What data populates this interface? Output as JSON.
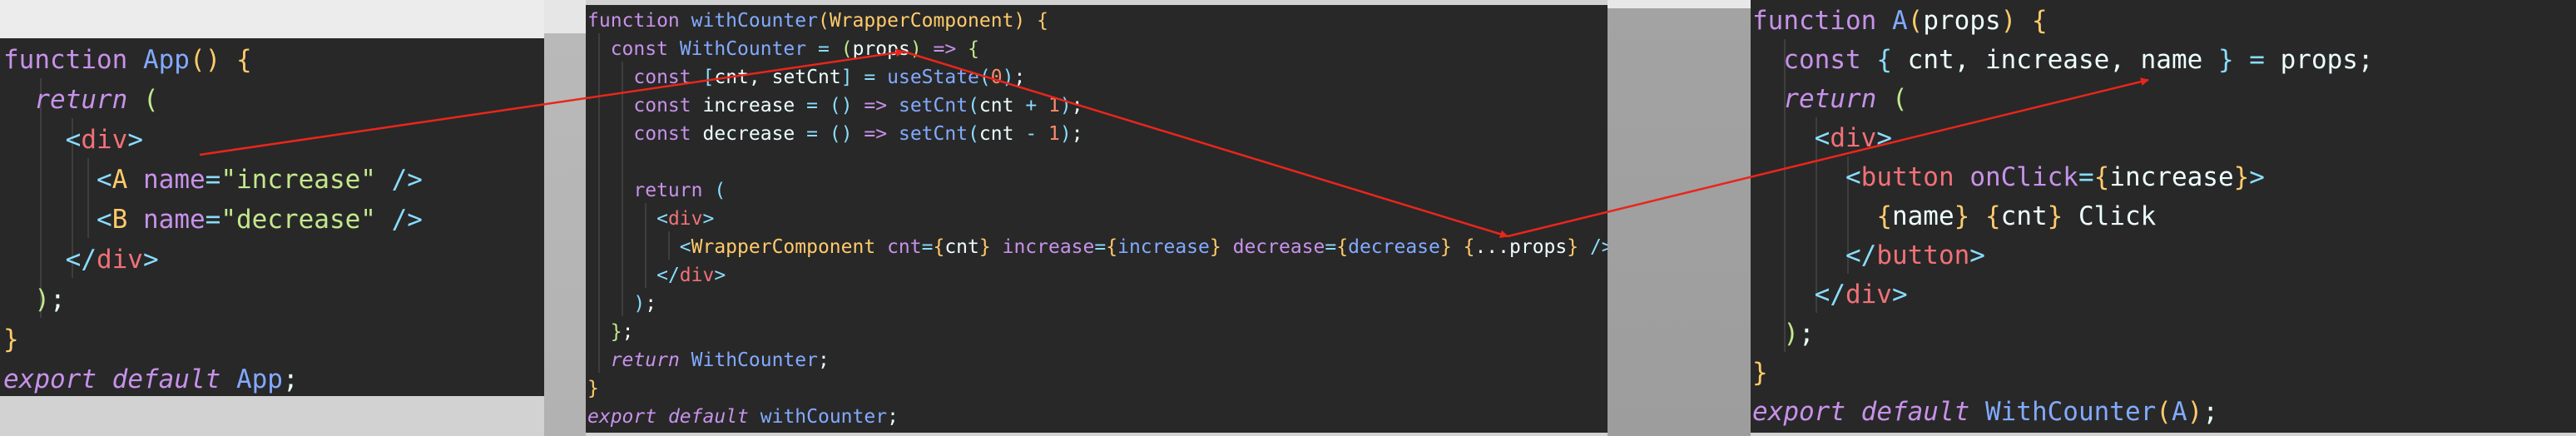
{
  "colors": {
    "editor_bg": "#282828",
    "arrow": "#e8261c"
  },
  "panel_app": {
    "lines": [
      [
        [
          "kw",
          "function"
        ],
        [
          "tx",
          " "
        ],
        [
          "fn",
          "App"
        ],
        [
          "br",
          "()"
        ],
        [
          "tx",
          " "
        ],
        [
          "br",
          "{"
        ]
      ],
      [
        [
          "tx",
          "  "
        ],
        [
          "kwi",
          "return"
        ],
        [
          "tx",
          " "
        ],
        [
          "pn",
          "("
        ]
      ],
      [
        [
          "tx",
          "    "
        ],
        [
          "op",
          "<"
        ],
        [
          "tg",
          "div"
        ],
        [
          "op",
          ">"
        ]
      ],
      [
        [
          "tx",
          "      "
        ],
        [
          "op",
          "<"
        ],
        [
          "br",
          "A"
        ],
        [
          "tx",
          " "
        ],
        [
          "at",
          "name"
        ],
        [
          "op",
          "="
        ],
        [
          "st",
          "\"increase\""
        ],
        [
          "tx",
          " "
        ],
        [
          "op",
          "/>"
        ]
      ],
      [
        [
          "tx",
          "      "
        ],
        [
          "op",
          "<"
        ],
        [
          "br",
          "B"
        ],
        [
          "tx",
          " "
        ],
        [
          "at",
          "name"
        ],
        [
          "op",
          "="
        ],
        [
          "st",
          "\"decrease\""
        ],
        [
          "tx",
          " "
        ],
        [
          "op",
          "/>"
        ]
      ],
      [
        [
          "tx",
          "    "
        ],
        [
          "op",
          "</"
        ],
        [
          "tg",
          "div"
        ],
        [
          "op",
          ">"
        ]
      ],
      [
        [
          "tx",
          "  "
        ],
        [
          "pn",
          ")"
        ],
        [
          "tx",
          ";"
        ]
      ],
      [
        [
          "br",
          "}"
        ]
      ],
      [
        [
          "kwi",
          "export"
        ],
        [
          "tx",
          " "
        ],
        [
          "kwi",
          "default"
        ],
        [
          "tx",
          " "
        ],
        [
          "fn",
          "App"
        ],
        [
          "tx",
          ";"
        ]
      ]
    ]
  },
  "panel_hoc": {
    "lines": [
      [
        [
          "kw",
          "function"
        ],
        [
          "tx",
          " "
        ],
        [
          "fn",
          "withCounter"
        ],
        [
          "br",
          "("
        ],
        [
          "br",
          "WrapperComponent"
        ],
        [
          "br",
          ")"
        ],
        [
          "tx",
          " "
        ],
        [
          "br",
          "{"
        ]
      ],
      [
        [
          "tx",
          "  "
        ],
        [
          "kw",
          "const"
        ],
        [
          "tx",
          " "
        ],
        [
          "fn",
          "WithCounter"
        ],
        [
          "tx",
          " "
        ],
        [
          "op",
          "="
        ],
        [
          "tx",
          " "
        ],
        [
          "pn",
          "("
        ],
        [
          "tx",
          "props"
        ],
        [
          "pn",
          ")"
        ],
        [
          "tx",
          " "
        ],
        [
          "kw",
          "=>"
        ],
        [
          "tx",
          " "
        ],
        [
          "pn",
          "{"
        ]
      ],
      [
        [
          "tx",
          "    "
        ],
        [
          "kw",
          "const"
        ],
        [
          "tx",
          " "
        ],
        [
          "op",
          "["
        ],
        [
          "tx",
          "cnt, setCnt"
        ],
        [
          "op",
          "]"
        ],
        [
          "tx",
          " "
        ],
        [
          "op",
          "="
        ],
        [
          "tx",
          " "
        ],
        [
          "fn",
          "useState"
        ],
        [
          "pl",
          "("
        ],
        [
          "nm",
          "0"
        ],
        [
          "pl",
          ")"
        ],
        [
          "tx",
          ";"
        ]
      ],
      [
        [
          "tx",
          "    "
        ],
        [
          "kw",
          "const"
        ],
        [
          "tx",
          " increase "
        ],
        [
          "op",
          "="
        ],
        [
          "tx",
          " "
        ],
        [
          "pl",
          "()"
        ],
        [
          "tx",
          " "
        ],
        [
          "kw",
          "=>"
        ],
        [
          "tx",
          " "
        ],
        [
          "fn",
          "setCnt"
        ],
        [
          "pl",
          "("
        ],
        [
          "tx",
          "cnt "
        ],
        [
          "op",
          "+"
        ],
        [
          "tx",
          " "
        ],
        [
          "nm",
          "1"
        ],
        [
          "pl",
          ")"
        ],
        [
          "tx",
          ";"
        ]
      ],
      [
        [
          "tx",
          "    "
        ],
        [
          "kw",
          "const"
        ],
        [
          "tx",
          " decrease "
        ],
        [
          "op",
          "="
        ],
        [
          "tx",
          " "
        ],
        [
          "pl",
          "()"
        ],
        [
          "tx",
          " "
        ],
        [
          "kw",
          "=>"
        ],
        [
          "tx",
          " "
        ],
        [
          "fn",
          "setCnt"
        ],
        [
          "pl",
          "("
        ],
        [
          "tx",
          "cnt "
        ],
        [
          "op",
          "-"
        ],
        [
          "tx",
          " "
        ],
        [
          "nm",
          "1"
        ],
        [
          "pl",
          ")"
        ],
        [
          "tx",
          ";"
        ]
      ],
      [],
      [
        [
          "tx",
          "    "
        ],
        [
          "kw",
          "return"
        ],
        [
          "tx",
          " "
        ],
        [
          "pl",
          "("
        ]
      ],
      [
        [
          "tx",
          "      "
        ],
        [
          "op",
          "<"
        ],
        [
          "tg",
          "div"
        ],
        [
          "op",
          ">"
        ]
      ],
      [
        [
          "tx",
          "        "
        ],
        [
          "op",
          "<"
        ],
        [
          "br",
          "WrapperComponent"
        ],
        [
          "tx",
          " "
        ],
        [
          "at",
          "cnt"
        ],
        [
          "op",
          "="
        ],
        [
          "br",
          "{"
        ],
        [
          "tx",
          "cnt"
        ],
        [
          "br",
          "}"
        ],
        [
          "tx",
          " "
        ],
        [
          "at",
          "increase"
        ],
        [
          "op",
          "="
        ],
        [
          "br",
          "{"
        ],
        [
          "fn",
          "increase"
        ],
        [
          "br",
          "}"
        ],
        [
          "tx",
          " "
        ],
        [
          "at",
          "decrease"
        ],
        [
          "op",
          "="
        ],
        [
          "br",
          "{"
        ],
        [
          "fn",
          "decrease"
        ],
        [
          "br",
          "}"
        ],
        [
          "tx",
          " "
        ],
        [
          "br",
          "{"
        ],
        [
          "tx",
          "...props"
        ],
        [
          "br",
          "}"
        ],
        [
          "tx",
          " "
        ],
        [
          "op",
          "/>"
        ]
      ],
      [
        [
          "tx",
          "      "
        ],
        [
          "op",
          "</"
        ],
        [
          "tg",
          "div"
        ],
        [
          "op",
          ">"
        ]
      ],
      [
        [
          "tx",
          "    "
        ],
        [
          "pl",
          ")"
        ],
        [
          "tx",
          ";"
        ]
      ],
      [
        [
          "tx",
          "  "
        ],
        [
          "pn",
          "}"
        ],
        [
          "tx",
          ";"
        ]
      ],
      [
        [
          "tx",
          "  "
        ],
        [
          "kwi",
          "return"
        ],
        [
          "tx",
          " "
        ],
        [
          "fn",
          "WithCounter"
        ],
        [
          "tx",
          ";"
        ]
      ],
      [
        [
          "br",
          "}"
        ]
      ],
      [
        [
          "kwi",
          "export"
        ],
        [
          "tx",
          " "
        ],
        [
          "kwi",
          "default"
        ],
        [
          "tx",
          " "
        ],
        [
          "fn",
          "withCounter"
        ],
        [
          "tx",
          ";"
        ]
      ]
    ]
  },
  "panel_a": {
    "lines": [
      [
        [
          "kw",
          "function"
        ],
        [
          "tx",
          " "
        ],
        [
          "fn",
          "A"
        ],
        [
          "br",
          "("
        ],
        [
          "tx",
          "props"
        ],
        [
          "br",
          ")"
        ],
        [
          "tx",
          " "
        ],
        [
          "br",
          "{"
        ]
      ],
      [
        [
          "tx",
          "  "
        ],
        [
          "kw",
          "const"
        ],
        [
          "tx",
          " "
        ],
        [
          "op",
          "{"
        ],
        [
          "tx",
          " cnt, increase, name "
        ],
        [
          "op",
          "}"
        ],
        [
          "tx",
          " "
        ],
        [
          "op",
          "="
        ],
        [
          "tx",
          " props;"
        ]
      ],
      [
        [
          "tx",
          "  "
        ],
        [
          "kwi",
          "return"
        ],
        [
          "tx",
          " "
        ],
        [
          "pn",
          "("
        ]
      ],
      [
        [
          "tx",
          "    "
        ],
        [
          "op",
          "<"
        ],
        [
          "tg",
          "div"
        ],
        [
          "op",
          ">"
        ]
      ],
      [
        [
          "tx",
          "      "
        ],
        [
          "op",
          "<"
        ],
        [
          "tg",
          "button"
        ],
        [
          "tx",
          " "
        ],
        [
          "at",
          "onClick"
        ],
        [
          "op",
          "="
        ],
        [
          "br",
          "{"
        ],
        [
          "tx",
          "increase"
        ],
        [
          "br",
          "}"
        ],
        [
          "op",
          ">"
        ]
      ],
      [
        [
          "tx",
          "        "
        ],
        [
          "br",
          "{"
        ],
        [
          "tx",
          "name"
        ],
        [
          "br",
          "}"
        ],
        [
          "tx",
          " "
        ],
        [
          "br",
          "{"
        ],
        [
          "tx",
          "cnt"
        ],
        [
          "br",
          "}"
        ],
        [
          "tx",
          " Click"
        ]
      ],
      [
        [
          "tx",
          "      "
        ],
        [
          "op",
          "</"
        ],
        [
          "tg",
          "button"
        ],
        [
          "op",
          ">"
        ]
      ],
      [
        [
          "tx",
          "    "
        ],
        [
          "op",
          "</"
        ],
        [
          "tg",
          "div"
        ],
        [
          "op",
          ">"
        ]
      ],
      [
        [
          "tx",
          "  "
        ],
        [
          "pn",
          ")"
        ],
        [
          "tx",
          ";"
        ]
      ],
      [
        [
          "br",
          "}"
        ]
      ],
      [
        [
          "kwi",
          "export"
        ],
        [
          "tx",
          " "
        ],
        [
          "kwi",
          "default"
        ],
        [
          "tx",
          " "
        ],
        [
          "fn",
          "WithCounter"
        ],
        [
          "br",
          "("
        ],
        [
          "fn",
          "A"
        ],
        [
          "br",
          ")"
        ],
        [
          "tx",
          ";"
        ]
      ]
    ]
  }
}
